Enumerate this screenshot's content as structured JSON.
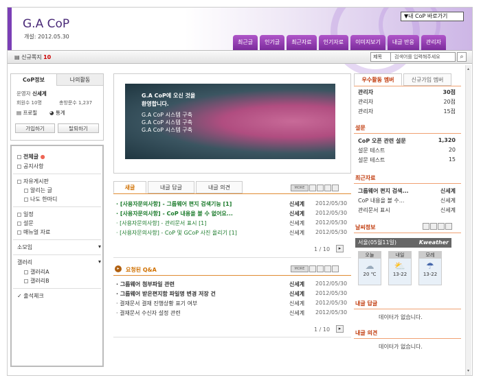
{
  "header": {
    "title": "G.A CoP",
    "opened": "개설: 2012.05.30",
    "cop_select": "▼내 CoP 바로가기",
    "tabs": [
      "최근글",
      "인기글",
      "최근자료",
      "인기자료",
      "이미지보기",
      "내글 반응",
      "관리자"
    ]
  },
  "subbar": {
    "new_label": "신규쪽지",
    "new_count": "10",
    "search_scope": "제목",
    "search_placeholder": "검색어를 입력해주세요"
  },
  "left": {
    "tabs": [
      "CoP정보",
      "나의활동"
    ],
    "operator_label": "운영자",
    "operator": "신세계",
    "members": "회원수 10명",
    "posts": "총방문수 1,237",
    "profile": "프로필",
    "stats": "통계",
    "join": "가입하기",
    "leave": "탈퇴하기",
    "menu": [
      "전체글",
      "공지사항",
      "자유게시판",
      "알리는 글",
      "나도 한마디",
      "일정",
      "설문",
      "매뉴얼 자료",
      "소모임",
      "갤러리",
      "갤러리A",
      "갤러리B",
      "출석체크"
    ]
  },
  "banner": {
    "line1": "G.A CoP에 오신 것을",
    "line2": "환영합니다.",
    "items": [
      "G.A CoP 시스템 구축",
      "G.A CoP 시스템 구축",
      "G.A CoP 시스템 구축"
    ]
  },
  "board": {
    "tabs": [
      "새글",
      "내글 답글",
      "내글 의견"
    ],
    "rows": [
      {
        "t": "· [사용자문의사항] - 그룹웨어 편지 검색기능 [1]",
        "a": "신세계",
        "d": "2012/05/30"
      },
      {
        "t": "· [사용자문의사항] - CoP 내용을 볼 수 없어요...",
        "a": "신세계",
        "d": "2012/05/30"
      },
      {
        "t": "· [사용자문의사항] - 관리문서 표시 [1]",
        "a": "신세계",
        "d": "2012/05/30"
      },
      {
        "t": "· [사용자문의사항] - CoP 및 GCoP 사진 올리기 [1]",
        "a": "신세계",
        "d": "2012/05/30"
      }
    ],
    "pager": "1 / 10"
  },
  "qa": {
    "title": "요청된 Q&A",
    "rows": [
      {
        "t": "· 그룹웨어 첨부파일 관련",
        "a": "신세계",
        "d": "2012/05/30"
      },
      {
        "t": "· 그룹웨어 받은편지함 파일명 변경 저장 건",
        "a": "신세계",
        "d": "2012/05/30"
      },
      {
        "t": "· 결재문서 결재 진행상황 표기 여부",
        "a": "신세계",
        "d": "2012/05/30"
      },
      {
        "t": "· 결재문서 수신자 설정 관련",
        "a": "신세계",
        "d": "2012/05/30"
      }
    ],
    "pager": "1 / 10"
  },
  "right": {
    "rank_tabs": [
      "우수활동 멤버",
      "신규가입 멤버"
    ],
    "rank": [
      {
        "n": "관리자",
        "v": "30점"
      },
      {
        "n": "관리자",
        "v": "20점"
      },
      {
        "n": "관리자",
        "v": "15점"
      }
    ],
    "poll_title": "설문",
    "poll": [
      {
        "n": "CoP 오픈 관련 설문",
        "v": "1,320"
      },
      {
        "n": "설문 테스트",
        "v": "20"
      },
      {
        "n": "설문 테스트",
        "v": "15"
      }
    ],
    "recent_title": "최근자료",
    "recent": [
      {
        "n": "그룹웨어 편지 검색...",
        "v": "신세계"
      },
      {
        "n": "CoP 내용을 볼 수...",
        "v": "신세계"
      },
      {
        "n": "관리문서 표시",
        "v": "신세계"
      }
    ],
    "weather_title": "날씨정보",
    "weather_city": "서울(05월11일)",
    "weather_brand": "Kweather",
    "weather": [
      {
        "d": "오늘",
        "t": "20 ℃"
      },
      {
        "d": "내일",
        "t": "13-22"
      },
      {
        "d": "모레",
        "t": "13-22"
      }
    ],
    "reply_title": "내글 답글",
    "reply_empty": "데이터가 없습니다.",
    "opinion_title": "내글 의견",
    "opinion_empty": "데이터가 없습니다."
  }
}
